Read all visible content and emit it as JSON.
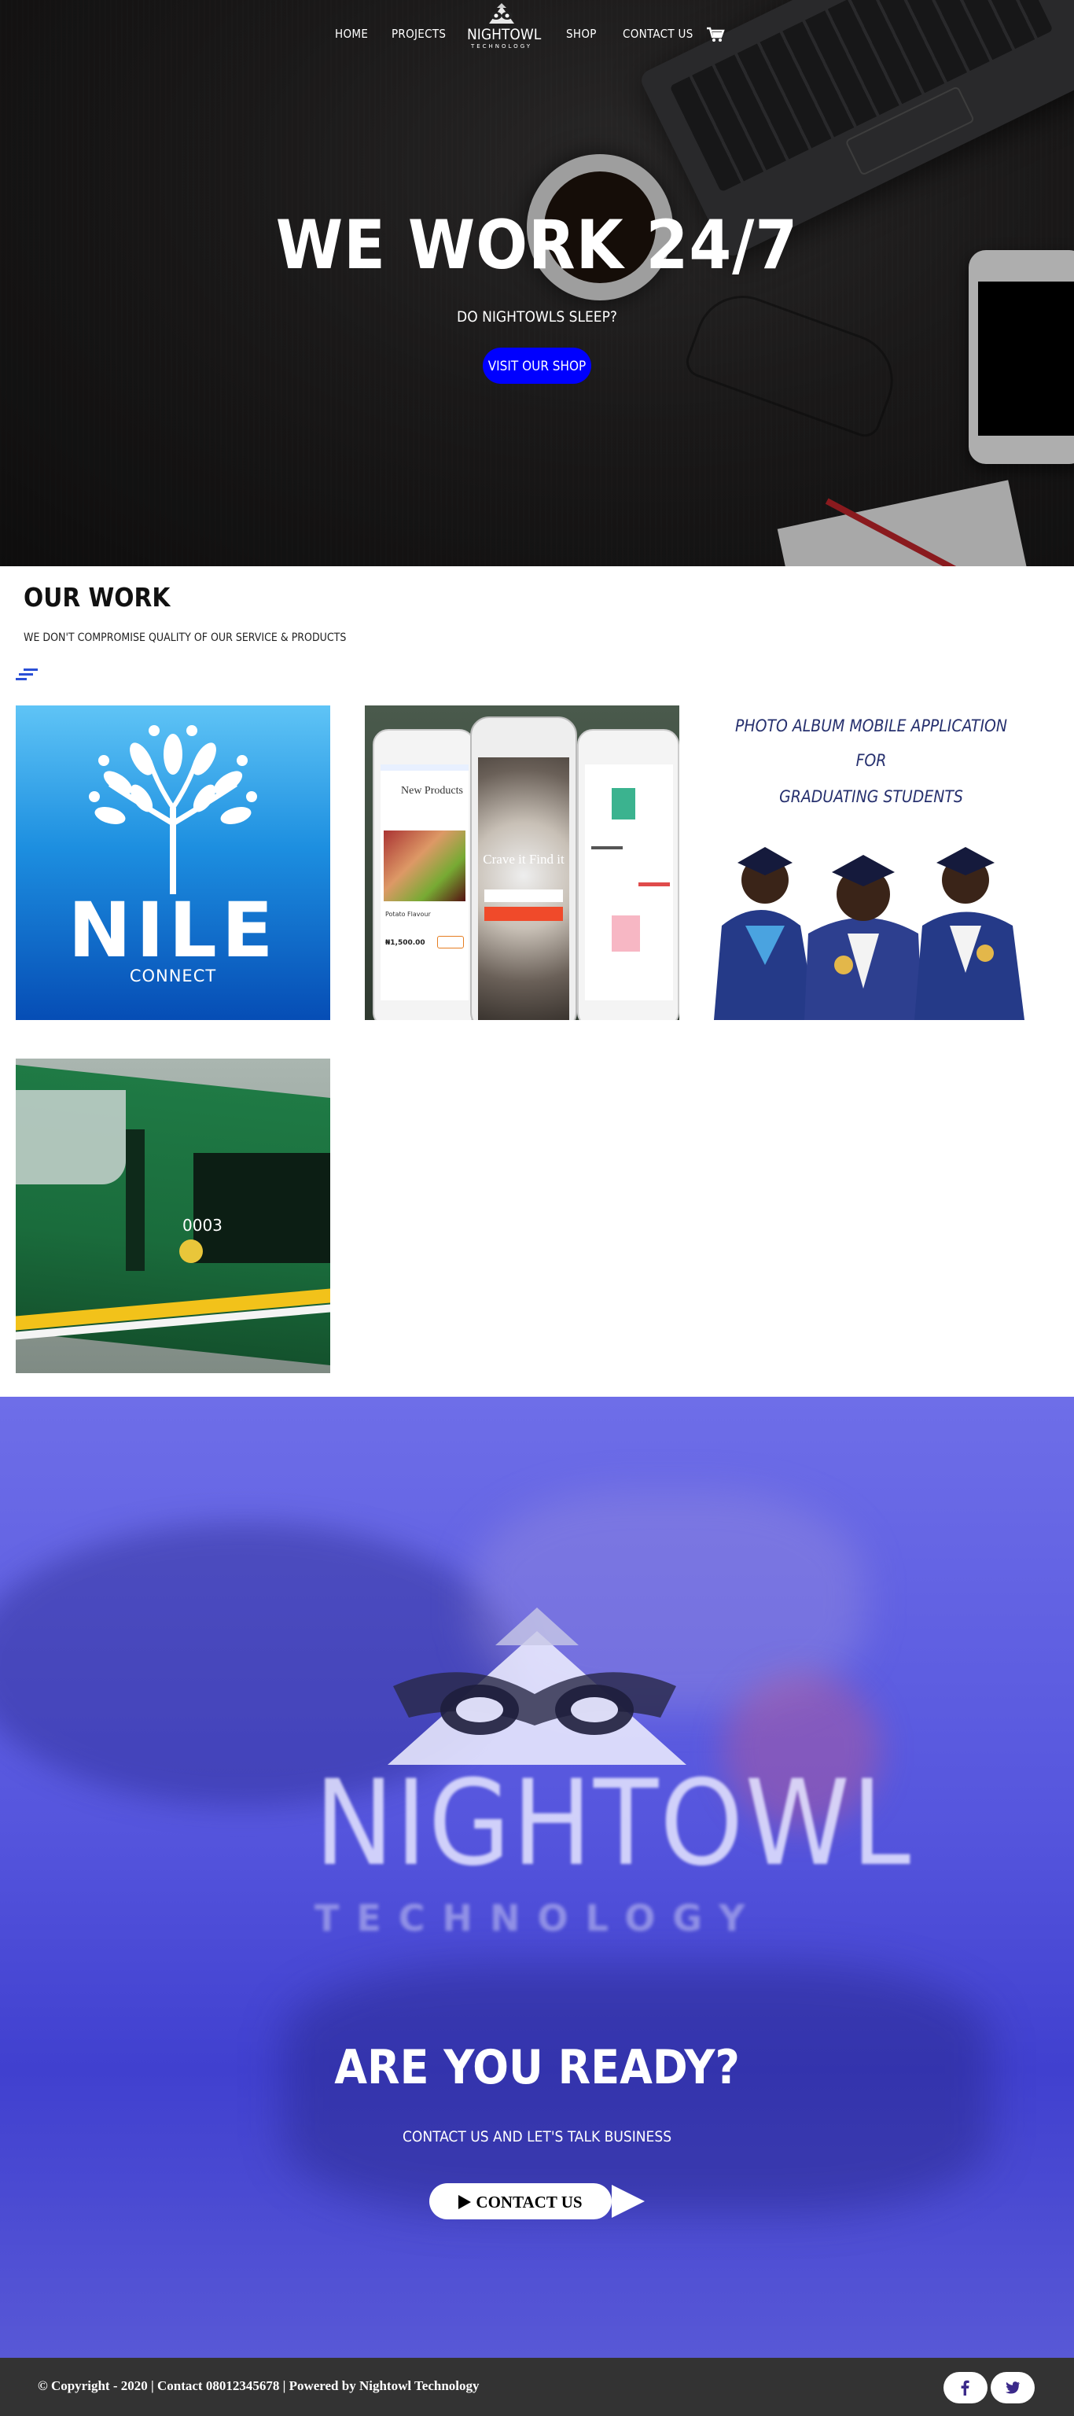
{
  "nav": {
    "links": [
      "HOME",
      "PROJECTS",
      "SHOP",
      "CONTACT US"
    ],
    "logo_brand": "NIGHTOWL",
    "logo_tagline": "TECHNOLOGY",
    "cart_icon": "cart-icon"
  },
  "hero": {
    "title": "WE WORK 24/7",
    "subtitle": "DO NIGHTOWLS SLEEP?",
    "button": "VISIT OUR SHOP",
    "button_color": "#0000ff"
  },
  "work": {
    "title": "OUR WORK",
    "subtitle": "WE DON'T COMPROMISE QUALITY OF OUR SERVICE & PRODUCTS",
    "filter_icon": "filter-icon",
    "accent_color": "#2a4fd6",
    "projects": [
      {
        "brand": "NILE",
        "caption": "CONNECT"
      },
      {
        "app_title": "New Products",
        "tagline": "Crave it Find it",
        "price": "₦1,500.00",
        "item": "Potato Flavour"
      },
      {
        "lines": [
          "PHOTO ALBUM MOBILE APPLICATION",
          "FOR",
          "GRADUATING STUDENTS"
        ]
      },
      {
        "train_number": "0003"
      }
    ]
  },
  "cta": {
    "logo_brand": "NIGHTOWL",
    "logo_tagline": "TECHNOLOGY",
    "title": "ARE YOU READY?",
    "subtitle": "CONTACT US AND LET'S TALK BUSINESS",
    "button": "CONTACT US",
    "overlay_color": "#5050d8"
  },
  "footer": {
    "copyright": "© Copyright - 2020 | Contact 08012345678 | Powered by Nightowl Technology",
    "social": [
      "facebook-icon",
      "twitter-icon"
    ],
    "social_color": "#3b2a8a"
  }
}
